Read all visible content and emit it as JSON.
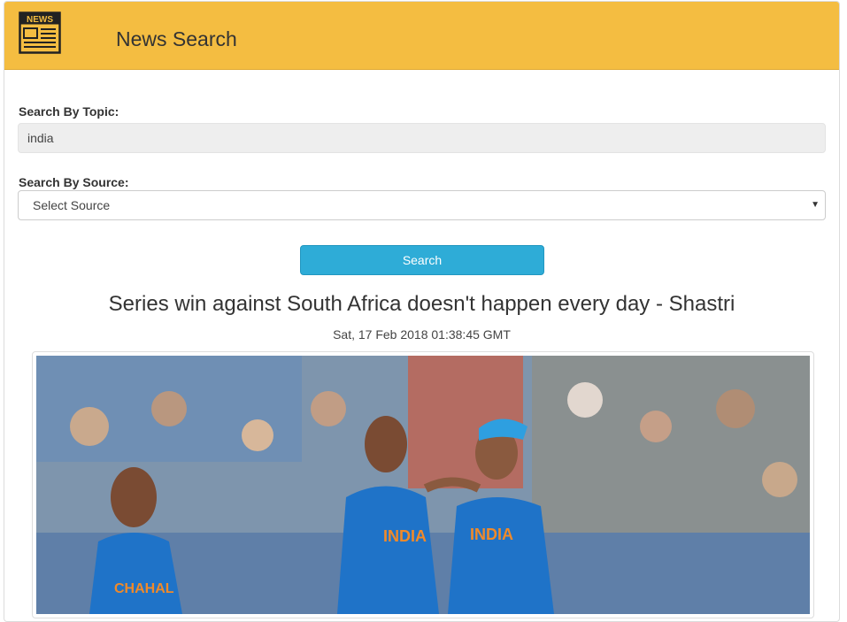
{
  "header": {
    "app_title": "News Search",
    "logo_text": "NEWS"
  },
  "search": {
    "topic_label": "Search By Topic:",
    "topic_value": "india",
    "source_label": "Search By Source:",
    "source_selected": "Select Source",
    "button_label": "Search"
  },
  "article": {
    "title": "Series win against South Africa doesn't happen every day - Shastri",
    "date": "Sat, 17 Feb 2018 01:38:45 GMT",
    "image_icon": "cricket-photo"
  },
  "colors": {
    "header_bg": "#f4bd41",
    "button_bg": "#2eacd7",
    "input_bg": "#eeeeee"
  }
}
